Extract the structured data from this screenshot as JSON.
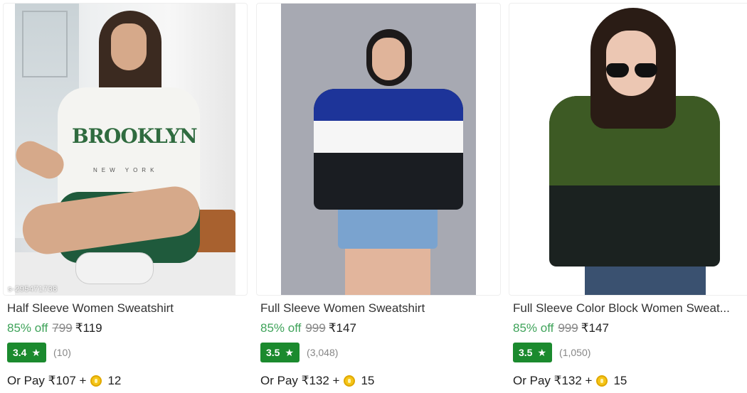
{
  "products": [
    {
      "title": "Half Sleeve Women Sweatshirt",
      "discount": "85% off",
      "mrp": "799",
      "price": "₹119",
      "rating": "3.4",
      "review_count": "(10)",
      "pay_prefix": "Or Pay ₹107 +",
      "coins": "12",
      "image_icon": "product-photo",
      "image_print_text": "BROOKLYN",
      "image_print_subtext": "NEW YORK",
      "watermark": "s-295471738"
    },
    {
      "title": "Full Sleeve Women Sweatshirt",
      "discount": "85% off",
      "mrp": "999",
      "price": "₹147",
      "rating": "3.5",
      "review_count": "(3,048)",
      "pay_prefix": "Or Pay ₹132 +",
      "coins": "15",
      "image_icon": "product-photo"
    },
    {
      "title": "Full Sleeve Color Block Women Sweat...",
      "discount": "85% off",
      "mrp": "999",
      "price": "₹147",
      "rating": "3.5",
      "review_count": "(1,050)",
      "pay_prefix": "Or Pay ₹132 +",
      "coins": "15",
      "image_icon": "product-photo"
    }
  ],
  "icons": {
    "rating": "star-icon",
    "coin": "coin-icon"
  },
  "colors": {
    "discount": "#3fa35a",
    "rating_badge": "#1b8a2e",
    "mrp": "#878787",
    "coin": "#f5c518"
  }
}
